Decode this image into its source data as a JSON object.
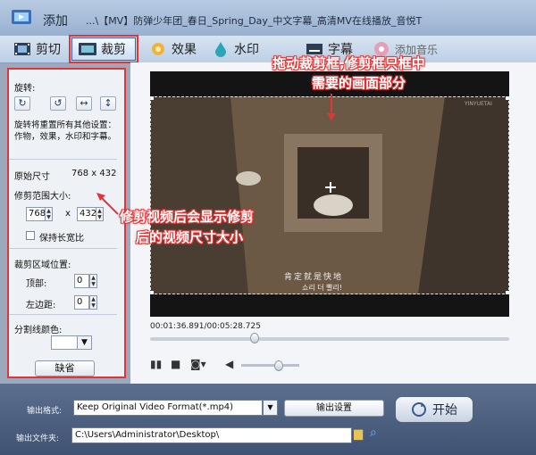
{
  "header": {
    "add_label": "添加",
    "filename": "...\\【MV】防弹少年团_春日_Spring_Day_中文字幕_高清MV在线播放_音悦T"
  },
  "tabs": [
    {
      "label": "剪切",
      "icon": "film-icon"
    },
    {
      "label": "裁剪",
      "icon": "crop-icon",
      "active": true
    },
    {
      "label": "效果",
      "icon": "sparkle-icon"
    },
    {
      "label": "水印",
      "icon": "water-drop-icon"
    },
    {
      "label": "字幕",
      "icon": "subtitle-icon"
    },
    {
      "label": "添加音乐",
      "icon": "music-icon"
    }
  ],
  "left_panel": {
    "rotate_label": "旋转:",
    "rotate_note": "旋转将重置所有其他设置：作物，效果，水印和字幕。",
    "original_size_label": "原始尺寸",
    "original_size_value": "768 x 432",
    "crop_size_label": "修剪范围大小:",
    "crop_width": "768",
    "crop_x": "x",
    "crop_height": "432",
    "keep_ratio_label": "保持长宽比",
    "crop_position_label": "裁剪区域位置:",
    "top_label": "顶部:",
    "top_value": "0",
    "left_label": "左边距:",
    "left_value": "0",
    "line_color_label": "分割线颜色:",
    "default_button": "缺省"
  },
  "video": {
    "subtitle_cn": "肯定就是快地",
    "subtitle_kr": "쇼리 더 빨리!",
    "corner_text": "YINYUETAI"
  },
  "player": {
    "timecode": "00:01:36.891/00:05:28.725",
    "progress": 0.29,
    "volume": 0.65
  },
  "annotations": {
    "top_line1": "拖动裁剪框,修剪框只框中",
    "top_line2": "需要的画面部分",
    "mid_line1": "修剪视频后会显示修剪",
    "mid_line2": "后的视频尺寸大小"
  },
  "bottom": {
    "format_label": "输出格式:",
    "format_value": "Keep Original Video Format(*.mp4)",
    "settings_button": "输出设置",
    "folder_label": "输出文件夹:",
    "folder_value": "C:\\Users\\Administrator\\Desktop\\",
    "start_button": "开始"
  },
  "colors": {
    "annotation": "#e23535",
    "accent": "#2e64b8"
  }
}
